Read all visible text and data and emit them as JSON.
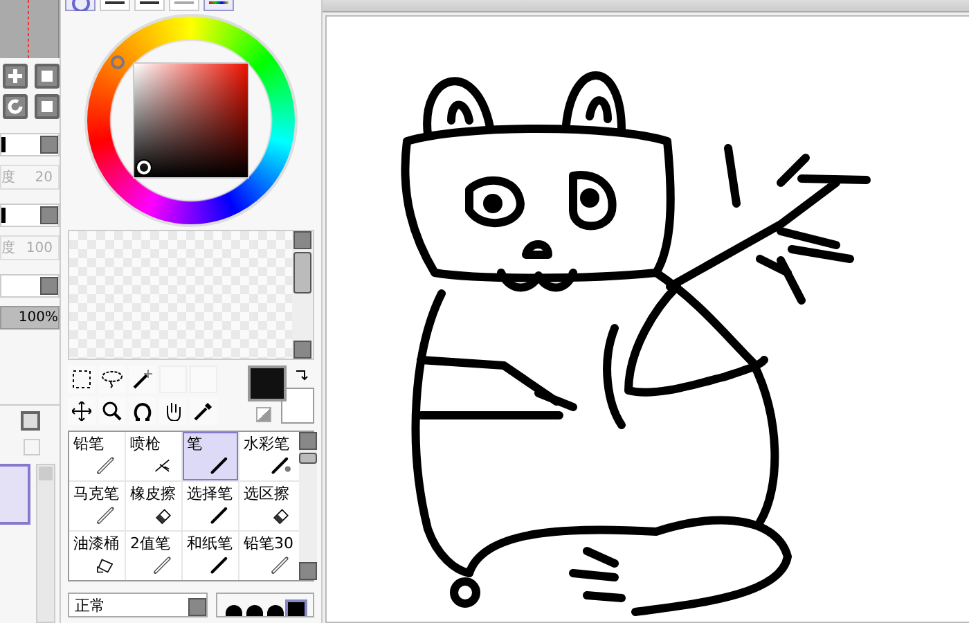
{
  "left_panel": {
    "density_rows": [
      {
        "label": "度",
        "value": "20"
      },
      {
        "label": "度",
        "value": "100"
      }
    ],
    "scale": "100%",
    "layers": [
      {
        "selected": true
      }
    ]
  },
  "brushes": [
    {
      "label": "铅笔",
      "kind": "pencil",
      "selected": false
    },
    {
      "label": "喷枪",
      "kind": "airbrush",
      "selected": false
    },
    {
      "label": "笔",
      "kind": "pen",
      "selected": true
    },
    {
      "label": "水彩笔",
      "kind": "watercolor",
      "selected": false
    },
    {
      "label": "马克笔",
      "kind": "marker",
      "selected": false
    },
    {
      "label": "橡皮擦",
      "kind": "eraser",
      "selected": false
    },
    {
      "label": "选择笔",
      "kind": "selpen",
      "selected": false
    },
    {
      "label": "选区擦",
      "kind": "selerase",
      "selected": false
    },
    {
      "label": "油漆桶",
      "kind": "bucket",
      "selected": false
    },
    {
      "label": "2值笔",
      "kind": "binary",
      "selected": false
    },
    {
      "label": "和纸笔",
      "kind": "pen",
      "selected": false
    },
    {
      "label": "铅笔30",
      "kind": "pencil",
      "selected": false
    }
  ],
  "blend_mode": "正常"
}
